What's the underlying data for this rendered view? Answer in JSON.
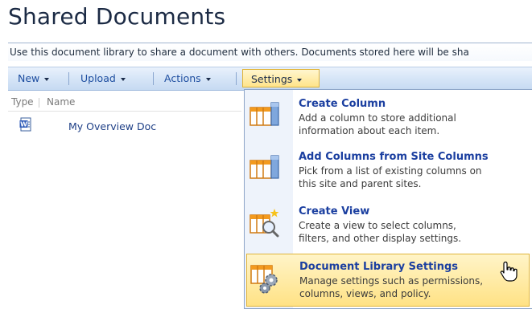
{
  "page": {
    "title": "Shared Documents",
    "description": "Use this document library to share a document with others. Documents stored here will be sha"
  },
  "toolbar": {
    "new_label": "New",
    "upload_label": "Upload",
    "actions_label": "Actions",
    "settings_label": "Settings"
  },
  "list": {
    "headers": {
      "type": "Type",
      "name": "Name"
    },
    "items": [
      {
        "name": "My Overview Doc",
        "icon": "word-document-icon"
      }
    ]
  },
  "settings_menu": {
    "items": [
      {
        "title": "Create Column",
        "desc_lines": [
          "Add a column to store additional",
          "information about each item."
        ],
        "icon": "create-column-icon"
      },
      {
        "title": "Add Columns from Site Columns",
        "desc_lines": [
          "Pick from a list of existing columns on",
          "this site and parent sites."
        ],
        "icon": "site-columns-icon"
      },
      {
        "title": "Create View",
        "desc_lines": [
          "Create a view to select columns,",
          "filters, and other display settings."
        ],
        "icon": "create-view-icon"
      },
      {
        "title": "Document Library Settings",
        "desc_lines": [
          "Manage settings such as permissions,",
          "columns, views, and policy."
        ],
        "icon": "library-settings-icon",
        "highlighted": true
      }
    ]
  },
  "colors": {
    "title_text": "#1b2a44",
    "link_blue": "#1e3f86",
    "menu_title_blue": "#1b3fa0",
    "highlight_fill": "#ffe285",
    "highlight_border": "#e0b43a"
  }
}
